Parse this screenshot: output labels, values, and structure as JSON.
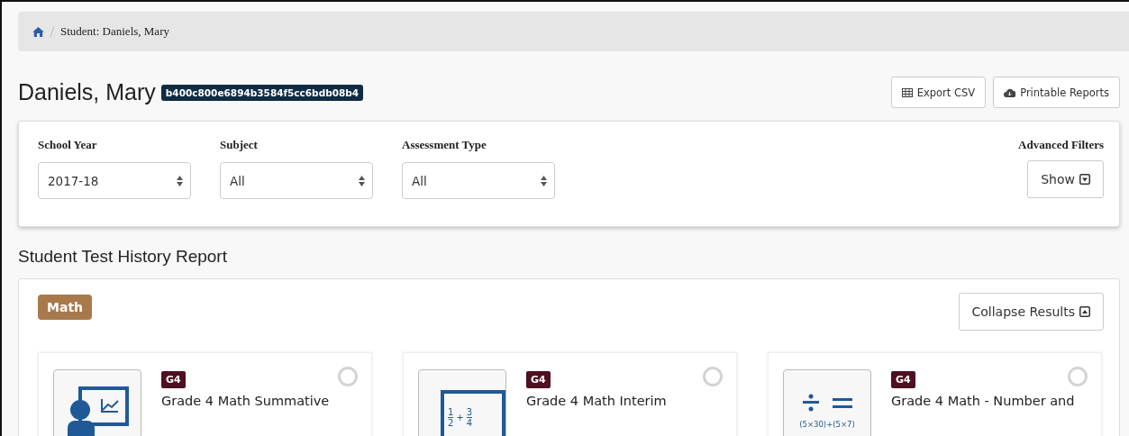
{
  "breadcrumb": {
    "current": "Student: Daniels, Mary"
  },
  "student": {
    "name": "Daniels, Mary",
    "id_badge": "b400c800e6894b3584f5cc6bdb08b4"
  },
  "header_buttons": [
    {
      "kind": "table",
      "label": "Export CSV"
    },
    {
      "kind": "cloud",
      "label": "Printable Reports"
    }
  ],
  "filters": [
    {
      "label": "School Year",
      "value": "2017-18"
    },
    {
      "label": "Subject",
      "value": "All"
    },
    {
      "label": "Assessment Type",
      "value": "All"
    }
  ],
  "advanced_filters": {
    "label": "Advanced Filters",
    "button": "Show"
  },
  "report_title": "Student Test History Report",
  "subject_group": {
    "subject": "Math",
    "collapse_button": "Collapse Results",
    "cards": [
      {
        "kind": "summative",
        "grade": "G4",
        "title": "Grade 4 Math Summative",
        "selected": false
      },
      {
        "kind": "interim",
        "grade": "G4",
        "title": "Grade 4 Math Interim",
        "selected": false,
        "fractions": [
          [
            "1",
            "2"
          ],
          [
            "3",
            "4"
          ]
        ],
        "operator": "+"
      },
      {
        "kind": "block",
        "grade": "G4",
        "title": "Grade 4 Math - Number and",
        "selected": false,
        "icon_text": "(5×30)+(5×7)"
      }
    ]
  }
}
